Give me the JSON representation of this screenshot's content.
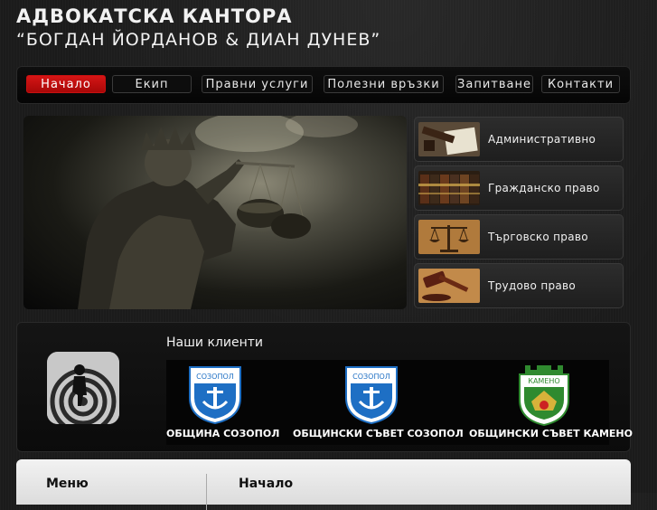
{
  "header": {
    "title": "АДВОКАТСКА КАНТОРА",
    "subtitle": "“БОГДАН ЙОРДАНОВ & ДИАН ДУНЕВ”"
  },
  "nav": [
    {
      "label": "Начало",
      "active": true
    },
    {
      "label": "Екип",
      "active": false
    },
    {
      "label": "Правни услуги",
      "active": false
    },
    {
      "label": "Полезни връзки",
      "active": false
    },
    {
      "label": "Запитване",
      "active": false
    },
    {
      "label": "Контакти",
      "active": false
    }
  ],
  "categories": [
    {
      "label": "Административно право",
      "icon": "document-gavel-icon"
    },
    {
      "label": "Гражданско право",
      "icon": "law-books-icon"
    },
    {
      "label": "Търговско право",
      "icon": "scales-icon"
    },
    {
      "label": "Трудово право",
      "icon": "gavel-icon"
    }
  ],
  "clients": {
    "title": "Наши клиенти",
    "items": [
      {
        "caption": "ОБЩИНА СОЗОПОЛ",
        "crest_text": "СОЗОПОЛ"
      },
      {
        "caption": "ОБЩИНСКИ СЪВЕТ СОЗОПОЛ",
        "crest_text": "СОЗОПОЛ"
      },
      {
        "caption": "ОБЩИНСКИ СЪВЕТ КАМЕНО",
        "crest_text": "КАМЕНО"
      }
    ]
  },
  "footer": {
    "menu_label": "Меню",
    "breadcrumb": "Начало"
  },
  "colors": {
    "accent": "#c81010",
    "background": "#1b1b1b",
    "crest_blue": "#1e6fc4",
    "crest_green": "#2f8a2f"
  }
}
